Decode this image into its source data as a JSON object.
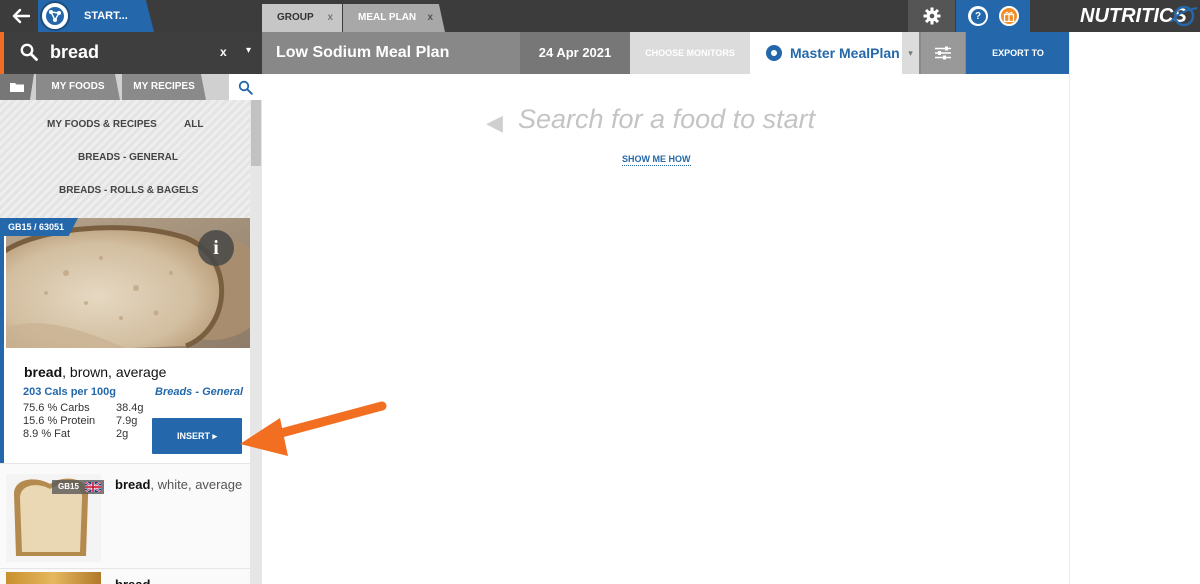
{
  "topbar": {
    "start_label": "START...",
    "tabs": [
      {
        "label": "GROUP",
        "close": "x"
      },
      {
        "label": "MEAL PLAN",
        "close": "x"
      }
    ],
    "help_glyph": "?",
    "brand": "NUTRITICS",
    "icons": [
      "back-arrow-icon",
      "app-logo-icon",
      "gear-icon",
      "help-icon",
      "gift-icon"
    ]
  },
  "search": {
    "value": "bread",
    "clear": "x",
    "dropdown": "▾"
  },
  "subtabs": {
    "my_foods": "MY FOODS",
    "my_recipes": "MY RECIPES"
  },
  "filters": {
    "my_foods_recipes": "MY FOODS & RECIPES",
    "all": "ALL",
    "breads_general": "BREADS - GENERAL",
    "breads_rolls": "BREADS - ROLLS & BAGELS"
  },
  "results": [
    {
      "code": "GB15 / 63051",
      "info": "i",
      "name_bold": "bread",
      "name_rest": ", brown, average",
      "cals": "203 Cals per 100g",
      "category": "Breads - General",
      "nutrients": [
        {
          "label": "75.6 % Carbs",
          "value": "38.4g"
        },
        {
          "label": "15.6 % Protein",
          "value": "7.9g"
        },
        {
          "label": "8.9 % Fat",
          "value": "2g"
        }
      ],
      "insert_label": "INSERT ▸"
    },
    {
      "code": "GB15",
      "name_bold": "bread",
      "name_rest": ", white, average"
    },
    {
      "name_bold": "bread"
    }
  ],
  "main": {
    "plan_title": "Low Sodium Meal Plan",
    "date": "24 Apr 2021",
    "choose_monitors": "CHOOSE MONITORS",
    "master_plan": "Master MealPlan",
    "master_drop": "▾",
    "export": "EXPORT TO",
    "placeholder_arrow": "◀",
    "placeholder": "Search for a food to start",
    "show_me_how": "SHOW ME HOW"
  },
  "colors": {
    "accent": "#2468ab",
    "orange": "#f26f21",
    "dark_bar": "#3c3c3c"
  }
}
